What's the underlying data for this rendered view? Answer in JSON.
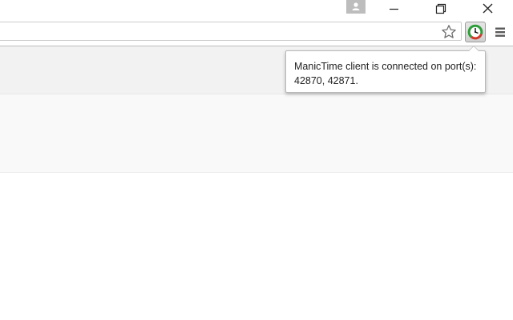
{
  "window": {
    "title_bar": {
      "buttons": [
        "profile",
        "minimize",
        "restore",
        "close"
      ]
    }
  },
  "toolbar": {
    "omnibox": {
      "value": ""
    },
    "icons": {
      "bookmark": "star-icon",
      "extension": "manictime-icon",
      "menu": "hamburger-menu-icon"
    }
  },
  "popup": {
    "line1": "ManicTime client is connected on port(s):",
    "line2": "42870, 42871."
  },
  "colors": {
    "manictime_green": "#2e9e3a",
    "manictime_red": "#d13a2a"
  }
}
